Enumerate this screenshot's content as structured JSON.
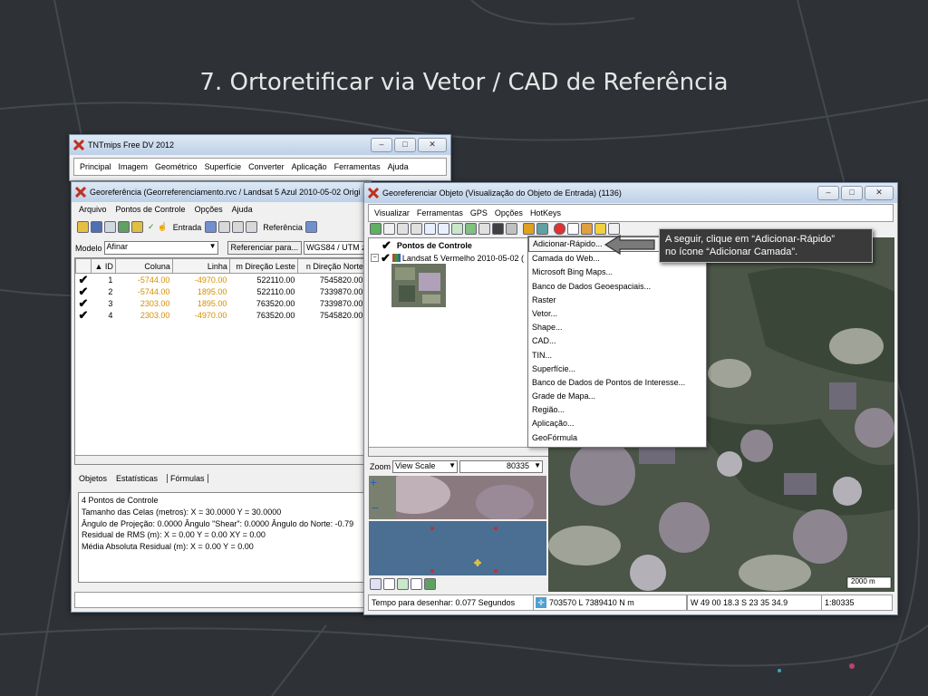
{
  "slide": {
    "title": "7. Ortoretificar via Vetor / CAD de Referência"
  },
  "tntmips": {
    "title": "TNTmips Free DV 2012",
    "menu": [
      "Principal",
      "Imagem",
      "Geométrico",
      "Superfície",
      "Converter",
      "Aplicação",
      "Ferramentas",
      "Ajuda"
    ]
  },
  "georef": {
    "title": "Georeferência (Georreferenciamento.rvc / Landsat 5 Azul 2010-05-02 Origi",
    "menu": [
      "Arquivo",
      "Pontos de Controle",
      "Opções",
      "Ajuda"
    ],
    "toolbar": {
      "entrada": "Entrada",
      "referencia": "Referência"
    },
    "modelo_label": "Modelo",
    "modelo_value": "Afinar",
    "referenciar_button": "Referenciar para...",
    "crs_value": "WGS84 / UTM zo",
    "columns": [
      "ID",
      "Coluna",
      "Linha",
      "m Direção Leste",
      "n Direção Norte"
    ],
    "rows": [
      {
        "id": "1",
        "coluna": "-5744.00",
        "linha": "-4970.00",
        "leste": "522110.00",
        "norte": "7545820.00"
      },
      {
        "id": "2",
        "coluna": "-5744.00",
        "linha": "1895.00",
        "leste": "522110.00",
        "norte": "7339870.00"
      },
      {
        "id": "3",
        "coluna": "2303.00",
        "linha": "1895.00",
        "leste": "763520.00",
        "norte": "7339870.00"
      },
      {
        "id": "4",
        "coluna": "2303.00",
        "linha": "-4970.00",
        "leste": "763520.00",
        "norte": "7545820.00"
      }
    ],
    "tabs": [
      "Objetos",
      "Estatísticas",
      "Fórmulas"
    ],
    "info": [
      "4 Pontos de Controle",
      "Tamanho das Celas (metros):  X = 30.0000  Y = 30.0000",
      "Ângulo de Projeção: 0.0000  Ângulo \"Shear\": 0.0000  Ângulo do Norte: -0.79",
      "Residual de RMS (m):  X = 0.00  Y = 0.00  XY = 0.00",
      "Média Absoluta Residual (m):  X = 0.00  Y = 0.00"
    ]
  },
  "viewer": {
    "title": "Georeferenciar Objeto (Visualização do Objeto de Entrada) (1136)",
    "menu": [
      "Visualizar",
      "Ferramentas",
      "GPS",
      "Opções",
      "HotKeys"
    ],
    "layers": {
      "group": "Pontos de Controle",
      "raster": "Landsat 5 Vermelho 2010-05-02 ("
    },
    "zoom_label": "Zoom",
    "zoom_mode": "View Scale",
    "zoom_value": "80335",
    "scalebar": "2000  m",
    "context_menu": [
      "Adicionar-Rápido...",
      "Camada do Web...",
      "Microsoft Bing Maps...",
      "Banco de Dados Geoespaciais...",
      "Raster",
      "Vetor...",
      "Shape...",
      "CAD...",
      "TIN...",
      "Superfície...",
      "Banco de Dados de Pontos de Interesse...",
      "Grade de Mapa...",
      "Região...",
      "Aplicação...",
      "GeoFórmula"
    ],
    "status": {
      "draw_time": "Tempo para desenhar: 0.077 Segundos",
      "coords_utm": "703570 L  7389410 N m",
      "coords_geo": "W 49 00 18.3  S 23 35 34.9",
      "scale": "1:80335"
    }
  },
  "callout": {
    "line1": "A seguir, clique em “Adicionar-Rápido”",
    "line2": "no ícone “Adicionar Camada”."
  },
  "colors": {
    "accent_orange": "#d49000",
    "callout_bg": "#3a3a3a",
    "slide_bg": "#2e3236"
  }
}
